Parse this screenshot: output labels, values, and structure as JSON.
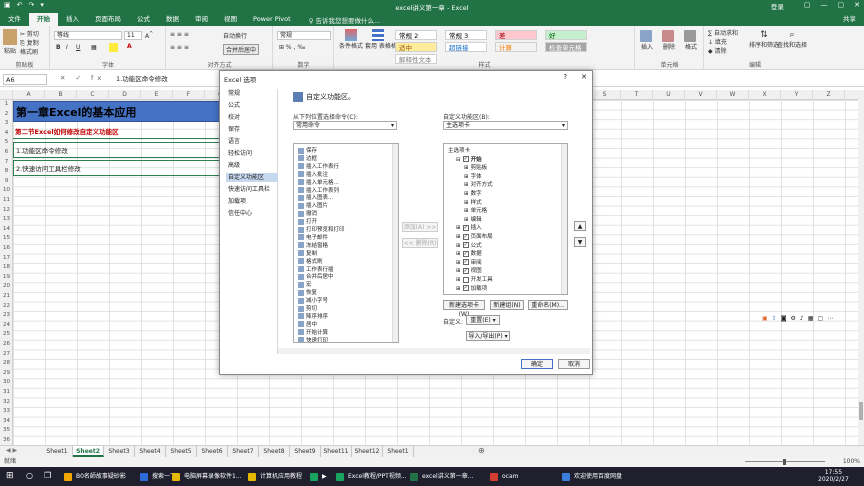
{
  "window": {
    "title": "excel讲义第一章 - Excel",
    "login": "登录",
    "controls": [
      "▢",
      "—",
      "▢",
      "✕"
    ],
    "qat": [
      "↶",
      "↷",
      "▾"
    ]
  },
  "ribbon_tabs": [
    "文件",
    "开始",
    "插入",
    "页面布局",
    "公式",
    "数据",
    "审阅",
    "视图",
    "Power Pivot"
  ],
  "active_tab": "开始",
  "tell_me": "♀ 告诉我您想要做什么...",
  "share": "共享",
  "ribbon": {
    "clipboard": {
      "paste": "粘贴",
      "cut": "✂ 剪切",
      "copy": "⎘ 复制",
      "painter": "格式刷",
      "label": "剪贴板"
    },
    "font": {
      "name": "等线",
      "size": "11",
      "label": "字体",
      "bold": "B",
      "italic": "I",
      "underline": "U"
    },
    "alignment": {
      "wrap": "自动换行",
      "merge": "合并后居中",
      "label": "对齐方式"
    },
    "number": {
      "format": "常规",
      "label": "数字"
    },
    "styles": {
      "conditional": "条件格式",
      "table": "套用\n表格格式",
      "items": [
        {
          "text": "常规 2",
          "bg": "#ffffff",
          "color": "#000000"
        },
        {
          "text": "常规 3",
          "bg": "#ffffff",
          "color": "#000000"
        },
        {
          "text": "差",
          "bg": "#ffc7ce",
          "color": "#9c0006"
        },
        {
          "text": "好",
          "bg": "#c6efce",
          "color": "#006100"
        },
        {
          "text": "适中",
          "bg": "#ffeb9c",
          "color": "#9c5700"
        },
        {
          "text": "超链接",
          "bg": "#ffffff",
          "color": "#0563c1"
        },
        {
          "text": "计算",
          "bg": "#f2f2f2",
          "color": "#fa7d00"
        },
        {
          "text": "检查单元格",
          "bg": "#a5a5a5",
          "color": "#ffffff"
        },
        {
          "text": "解释性文本",
          "bg": "#ffffff",
          "color": "#7f7f7f"
        }
      ],
      "label": "样式"
    },
    "cells": {
      "insert": "插入",
      "delete": "删除",
      "format": "格式",
      "label": "单元格"
    },
    "editing": {
      "autosum": "∑ 自动求和",
      "fill": "↓ 填充",
      "clear": "◆ 清除",
      "sort": "排序和筛选",
      "find": "查找和选择",
      "label": "编辑"
    }
  },
  "name_box": "A6",
  "formula_icons": "✕ ✓ fx",
  "formula": "1.功能区命令修改",
  "columns": [
    "A",
    "B",
    "C",
    "D",
    "E",
    "F",
    "G",
    "H",
    "I",
    "J",
    "K",
    "L",
    "M",
    "N",
    "O",
    "P",
    "Q",
    "R",
    "S",
    "T",
    "U",
    "V",
    "W",
    "X",
    "Y",
    "Z"
  ],
  "rows": [
    "1",
    "2",
    "3",
    "4",
    "5",
    "6",
    "7",
    "8",
    "9",
    "10",
    "11",
    "12",
    "13",
    "14",
    "15",
    "16",
    "17",
    "18",
    "19",
    "20",
    "21",
    "22",
    "23",
    "24",
    "25",
    "26",
    "27",
    "28",
    "29",
    "30",
    "31",
    "32",
    "33",
    "34",
    "35",
    "36",
    "37",
    "38"
  ],
  "cells": {
    "r1": "第一章Excel的基本应用",
    "r2": "第二节Excel如何修改自定义功能区",
    "r3": "1.功能区命令修改",
    "r4": "2.快速访问工具栏修改"
  },
  "sheets": [
    "Sheet1",
    "Sheet2",
    "Sheet3",
    "Sheet4",
    "Sheet5",
    "Sheet6",
    "Sheet7",
    "Sheet8",
    "Sheet9",
    "Sheet11",
    "Sheet12",
    "Sheet1"
  ],
  "active_sheet": "Sheet2",
  "status": {
    "mode": "就绪",
    "zoom": "100%"
  },
  "taskbar": {
    "search": "在这里输入你要搜索的内容",
    "items": [
      {
        "text": "B0名師故事疑砂影",
        "color": "#f2a600"
      },
      {
        "text": "搜索一下",
        "color": "#2b6cd8"
      },
      {
        "text": "电脑屏幕录像软件1...",
        "color": "#e6b800"
      },
      {
        "text": "计算机应用教程",
        "color": "#e6b800"
      },
      {
        "text": "▶",
        "color": "#1aa260"
      },
      {
        "text": "Excel教程/PPT视频...",
        "color": "#1aa260"
      },
      {
        "text": "excel讲义第一章...",
        "color": "#217346"
      },
      {
        "text": "ocam",
        "color": "#d23f31"
      },
      {
        "text": "欢迎使用百度网盘",
        "color": "#3b7ddd"
      }
    ],
    "time": "17:55",
    "date": "2020/2/27"
  },
  "dialog": {
    "title": "Excel 选项",
    "nav": [
      "常规",
      "公式",
      "校对",
      "保存",
      "语言",
      "轻松访问",
      "高级",
      "自定义功能区",
      "快速访问工具栏",
      "加载项",
      "信任中心"
    ],
    "selected_nav": "自定义功能区",
    "header": "自定义功能区。",
    "left_label": "从下列位置选择命令(C):",
    "left_select": "常用命令",
    "right_label": "自定义功能区(B):",
    "right_select": "主选项卡",
    "commands": [
      "保存",
      "边框",
      "插入工作表行",
      "插入批注",
      "插入单元格...",
      "插入工作表列",
      "插入图表...",
      "插入图片",
      "撤消",
      "打开",
      "打印预览和打印",
      "电子邮件",
      "冻结窗格",
      "复制",
      "格式刷",
      "工作表行插",
      "合并后居中",
      "宏",
      "恢复",
      "减小字号",
      "剪切",
      "降序排序",
      "居中",
      "开始计算",
      "快速打印"
    ],
    "tree": [
      {
        "text": "主选项卡",
        "level": 0,
        "check": false
      },
      {
        "text": "开始",
        "level": 1,
        "check": true
      },
      {
        "text": "剪贴板",
        "level": 2,
        "check": false
      },
      {
        "text": "字体",
        "level": 2,
        "check": false
      },
      {
        "text": "对齐方式",
        "level": 2,
        "check": false
      },
      {
        "text": "数字",
        "level": 2,
        "check": false
      },
      {
        "text": "样式",
        "level": 2,
        "check": false
      },
      {
        "text": "单元格",
        "level": 2,
        "check": false
      },
      {
        "text": "编辑",
        "level": 2,
        "check": false
      },
      {
        "text": "插入",
        "level": 1,
        "check": true
      },
      {
        "text": "页面布局",
        "level": 1,
        "check": true
      },
      {
        "text": "公式",
        "level": 1,
        "check": true
      },
      {
        "text": "数据",
        "level": 1,
        "check": true
      },
      {
        "text": "审阅",
        "level": 1,
        "check": true
      },
      {
        "text": "视图",
        "level": 1,
        "check": true
      },
      {
        "text": "开发工具",
        "level": 1,
        "check": false
      },
      {
        "text": "加载项",
        "level": 1,
        "check": true
      }
    ],
    "add": "添加(A) >>",
    "remove": "<< 删除(R)",
    "new_tab": "新建选项卡(W)",
    "new_group": "新建组(N)",
    "rename": "重命名(M)...",
    "customize_label": "自定义:",
    "reset": "重置(E) ▾",
    "import_export": "导入/导出(P) ▾",
    "ok": "确定",
    "cancel": "取消",
    "up": "▲",
    "down": "▼"
  }
}
